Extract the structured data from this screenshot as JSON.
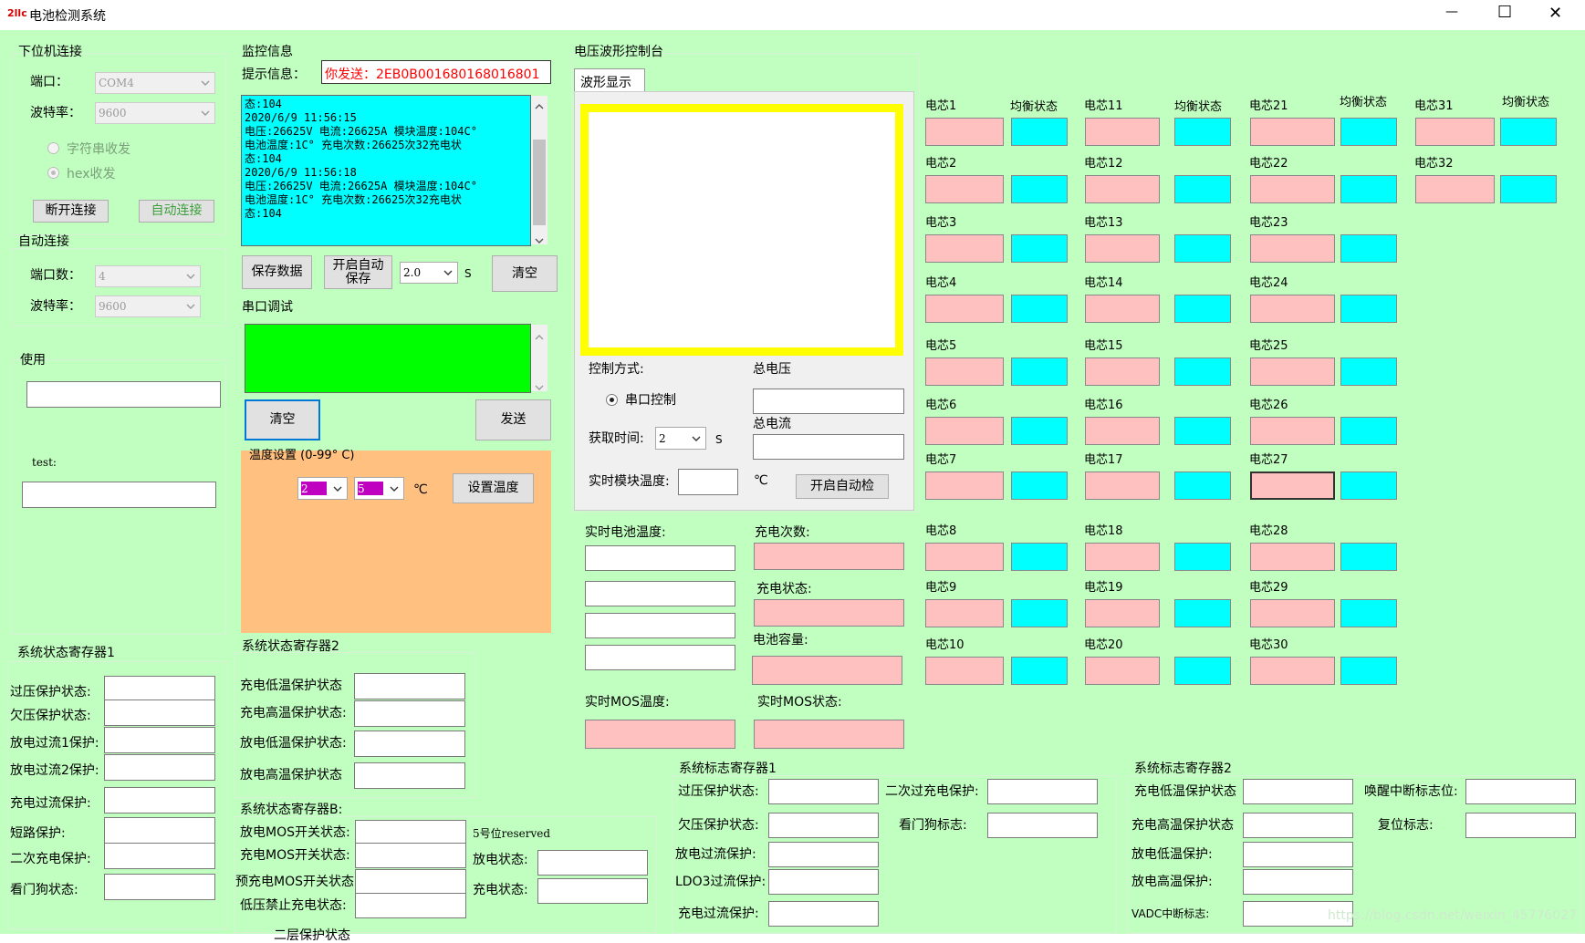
{
  "window": {
    "logo_text": "2llc",
    "title": "电池检测系统",
    "minimize_glyph": "—",
    "maximize_glyph": "☐",
    "close_glyph": "✕"
  },
  "colors": {
    "background": "#c1ffc1",
    "cell_voltage": "#ffc0c0",
    "balance_status": "#00ffff",
    "monitor_box": "#00ffff",
    "serial_box": "#00ff00",
    "temp_panel": "#ffc080",
    "waveform_border": "#ffff00",
    "temp_combo": "#c000c0",
    "tip_text": "#ff0000"
  },
  "lower_conn": {
    "title": "下位机连接",
    "port_label": "端口：",
    "port_value": "COM4",
    "baud_label": "波特率：",
    "baud_value": "9600",
    "radio_string": "字符串收发",
    "radio_hex": "hex收发",
    "disconnect_button": "断开连接",
    "autoconnect_button": "自动连接"
  },
  "auto_conn": {
    "title": "自动连接",
    "port_count_label": "端口数：",
    "port_count_value": "4",
    "baud_label": "波特率：",
    "baud_value": "9600"
  },
  "usage": {
    "title": "使用",
    "test_label": "test:"
  },
  "monitor": {
    "title": "监控信息",
    "tip_label": "提示信息：",
    "tip_value": "你发送：2EB0B001680168016801",
    "log_lines": [
      "态:104",
      "2020/6/9 11:56:15",
      "电压:26625V 电流:26625A 模块温度:104C°",
      "电池温度:1C° 充电次数:26625次32充电状",
      "态:104",
      "2020/6/9 11:56:18",
      "电压:26625V 电流:26625A 模块温度:104C°",
      "电池温度:1C° 充电次数:26625次32充电状",
      "态:104"
    ],
    "save_button": "保存数据",
    "auto_save_button_line1": "开启自动",
    "auto_save_button_line2": "保存",
    "interval_value": "2.0",
    "interval_unit": "S",
    "clear_button": "清空"
  },
  "serial_debug": {
    "title": "串口调试",
    "clear_button": "清空",
    "send_button": "发送"
  },
  "temp_settings": {
    "title": "温度设置 (0-99° C)",
    "min_value": "2",
    "max_value": "5",
    "unit": "℃",
    "set_button": "设置温度"
  },
  "sys_reg1": {
    "title": "系统状态寄存器1",
    "items": [
      "过压保护状态:",
      "欠压保护状态:",
      "放电过流1保护:",
      "放电过流2保护:",
      "充电过流保护:",
      "短路保护:",
      "二次充电保护:",
      "看门狗状态:"
    ]
  },
  "sys_reg2": {
    "title": "系统状态寄存器2",
    "items": [
      "充电低温保护状态",
      "充电高温保护状态:",
      "放电低温保护状态:",
      "放电高温保护状态"
    ]
  },
  "sys_regB": {
    "title": "系统状态寄存器B:",
    "items": [
      "放电MOS开关状态:",
      "充电MOS开关状态:",
      "预充电MOS开关状态",
      "低压禁止充电状态:"
    ],
    "reserved_label": "5号位reserved",
    "discharge_label": "放电状态:",
    "charge_label": "充电状态:",
    "cut_text": "二层保护状态"
  },
  "waveform": {
    "title": "电压波形控制台",
    "tab": "波形显示",
    "control_mode_label": "控制方式:",
    "serial_control": "串口控制",
    "fetch_time_label": "获取时间:",
    "fetch_time_value": "2",
    "fetch_time_unit": "S",
    "module_temp_label": "实时模块温度:",
    "module_temp_unit": "℃",
    "auto_check_button": "开启自动检",
    "total_voltage_label": "总电压",
    "total_current_label": "总电流"
  },
  "realtime": {
    "battery_temp_label": "实时电池温度:",
    "charge_count_label": "充电次数:",
    "charge_state_label": "充电状态:",
    "capacity_label": "电池容量:",
    "mos_temp_label": "实时MOS温度:",
    "mos_state_label": "实时MOS状态:"
  },
  "cells": {
    "balance_label": "均衡状态",
    "col1": [
      "电芯1",
      "电芯2",
      "电芯3",
      "电芯4",
      "电芯5",
      "电芯6",
      "电芯7",
      "电芯8",
      "电芯9",
      "电芯10"
    ],
    "col2": [
      "电芯11",
      "电芯12",
      "电芯13",
      "电芯14",
      "电芯15",
      "电芯16",
      "电芯17",
      "电芯18",
      "电芯19",
      "电芯20"
    ],
    "col3": [
      "电芯21",
      "电芯22",
      "电芯23",
      "电芯24",
      "电芯25",
      "电芯26",
      "电芯27",
      "电芯28",
      "电芯29",
      "电芯30"
    ],
    "col4": [
      "电芯31",
      "电芯32"
    ]
  },
  "sys_flag1": {
    "title": "系统标志寄存器1",
    "left": [
      "过压保护状态:",
      "欠压保护状态:",
      "放电过流保护:",
      "LDO3过流保护:",
      "充电过流保护:"
    ],
    "right": [
      "二次过充电保护:",
      "看门狗标志:"
    ]
  },
  "sys_flag2": {
    "title": "系统标志寄存器2",
    "left": [
      "充电低温保护状态",
      "充电高温保护状态",
      "放电低温保护:",
      "放电高温保护:",
      "VADC中断标志:"
    ],
    "right": [
      "唤醒中断标志位:",
      "复位标志:"
    ]
  },
  "watermark": "https://blog.csdn.net/weixin_45776027"
}
